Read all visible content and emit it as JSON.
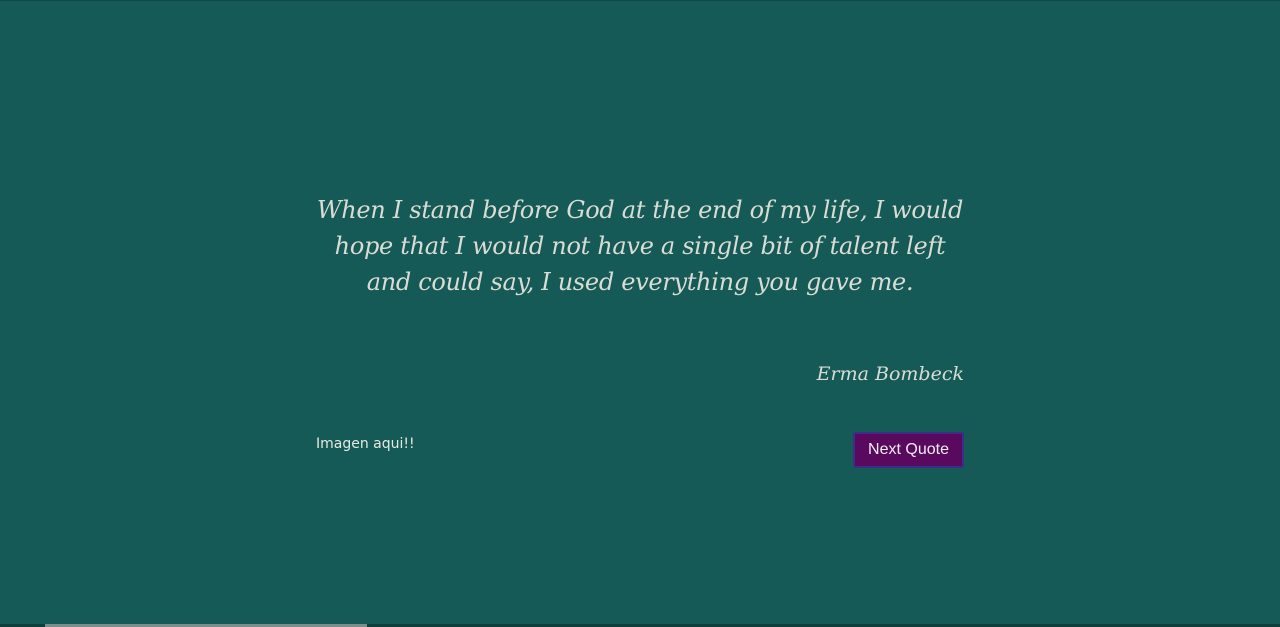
{
  "colors": {
    "background": "#155a56",
    "text": "#d9dcd4",
    "button_background": "#5a0a5e",
    "button_border": "#3c2e86"
  },
  "quote": {
    "text": "When I stand before God at the end of my life, I would hope that I would not have a single bit of talent left and could say, I used everything you gave me.",
    "author": "Erma Bombeck"
  },
  "image_placeholder": "Imagen aqui!!",
  "next_button": {
    "label": "Next Quote"
  }
}
